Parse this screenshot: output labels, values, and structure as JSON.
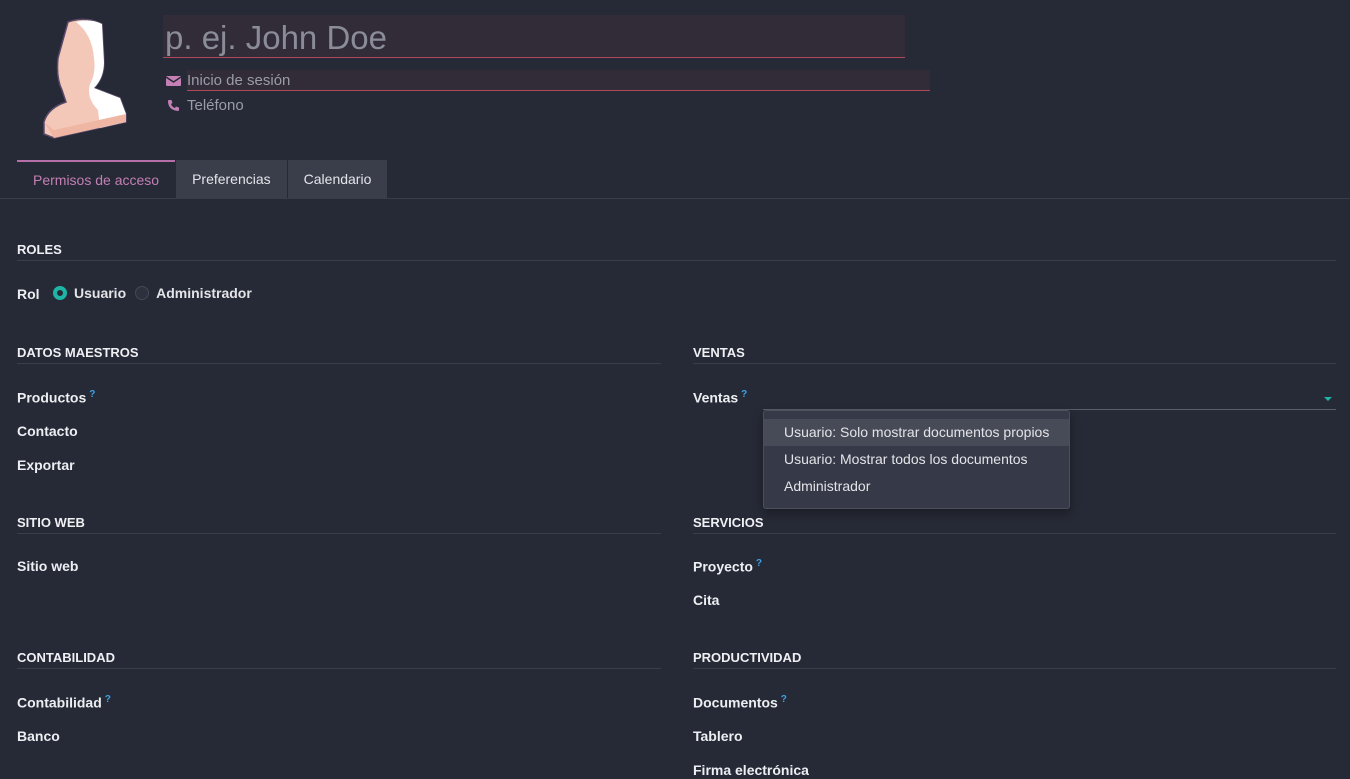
{
  "header": {
    "name_placeholder": "p. ej. John Doe",
    "login_placeholder": "Inicio de sesión",
    "phone_placeholder": "Teléfono"
  },
  "tabs": [
    {
      "label": "Permisos de acceso",
      "active": true
    },
    {
      "label": "Preferencias",
      "active": false
    },
    {
      "label": "Calendario",
      "active": false
    }
  ],
  "roles": {
    "title": "ROLES",
    "label": "Rol",
    "options": [
      {
        "label": "Usuario",
        "selected": true
      },
      {
        "label": "Administrador",
        "selected": false
      }
    ]
  },
  "sections": {
    "datos_maestros": {
      "title": "DATOS MAESTROS",
      "fields": [
        "Productos",
        "Contacto",
        "Exportar"
      ]
    },
    "ventas": {
      "title": "VENTAS",
      "fields": [
        "Ventas"
      ]
    },
    "sitio_web": {
      "title": "SITIO WEB",
      "fields": [
        "Sitio web"
      ]
    },
    "servicios": {
      "title": "SERVICIOS",
      "fields": [
        "Proyecto",
        "Cita"
      ]
    },
    "contabilidad": {
      "title": "CONTABILIDAD",
      "fields": [
        "Contabilidad",
        "Banco"
      ]
    },
    "productividad": {
      "title": "PRODUCTIVIDAD",
      "fields": [
        "Documentos",
        "Tablero",
        "Firma electrónica"
      ]
    }
  },
  "help_mark": "?",
  "ventas_dropdown": {
    "options": [
      "Usuario: Solo mostrar documentos propios",
      "Usuario: Mostrar todos los documentos",
      "Administrador"
    ],
    "highlighted_index": 0
  },
  "colors": {
    "background": "#262a36",
    "accent_purple": "#b46ea8",
    "accent_teal": "#1eb5a7",
    "help_blue": "#3da2e6",
    "invalid_red": "#b0485a"
  },
  "icons": {
    "login": "envelope-icon",
    "phone": "phone-icon",
    "avatar": "user-avatar-placeholder"
  }
}
